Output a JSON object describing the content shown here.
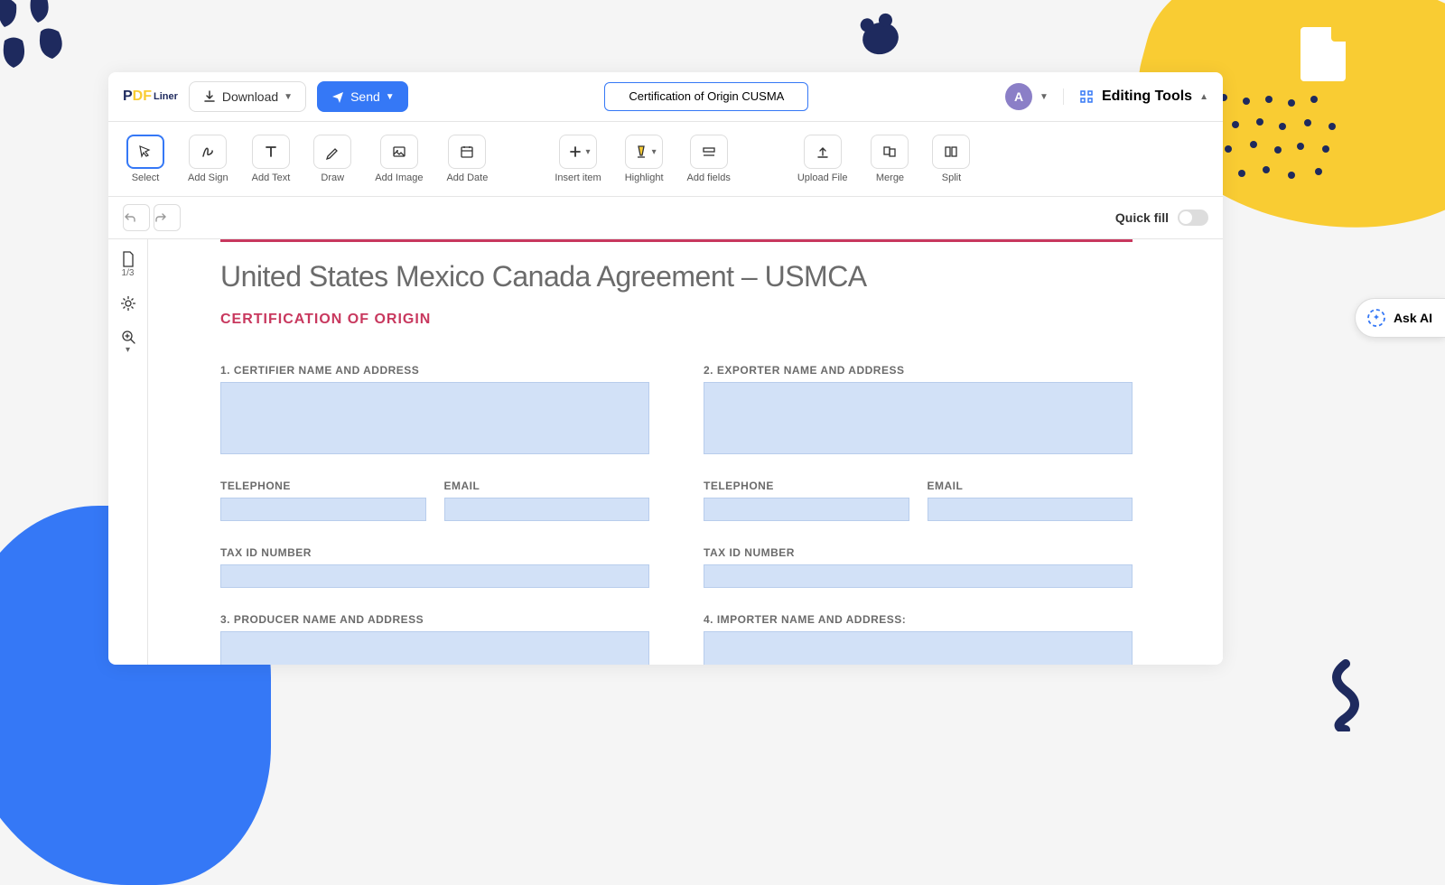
{
  "logo": {
    "p1": "P",
    "df": "DF",
    "liner": "Liner"
  },
  "header": {
    "download": "Download",
    "send": "Send",
    "doc_name": "Certification of Origin CUSMA",
    "avatar": "A",
    "editing_tools": "Editing Tools"
  },
  "toolbar": {
    "select": "Select",
    "add_sign": "Add Sign",
    "add_text": "Add Text",
    "draw": "Draw",
    "add_image": "Add Image",
    "add_date": "Add Date",
    "insert_item": "Insert item",
    "highlight": "Highlight",
    "add_fields": "Add fields",
    "upload_file": "Upload File",
    "merge": "Merge",
    "split": "Split"
  },
  "subheader": {
    "quick_fill": "Quick fill"
  },
  "rail": {
    "pages": "1/3"
  },
  "ask_ai": "Ask AI",
  "document": {
    "title": "United States Mexico Canada Agreement – USMCA",
    "subtitle": "CERTIFICATION OF ORIGIN",
    "section1": {
      "label": "1. CERTIFIER NAME AND ADDRESS",
      "telephone": "TELEPHONE",
      "email": "EMAIL",
      "taxid": "TAX ID NUMBER"
    },
    "section2": {
      "label": "2. EXPORTER NAME AND ADDRESS",
      "telephone": "TELEPHONE",
      "email": "EMAIL",
      "taxid": "TAX ID NUMBER"
    },
    "section3": {
      "label": "3. PRODUCER NAME AND ADDRESS"
    },
    "section4": {
      "label": "4. IMPORTER NAME AND ADDRESS:"
    }
  }
}
